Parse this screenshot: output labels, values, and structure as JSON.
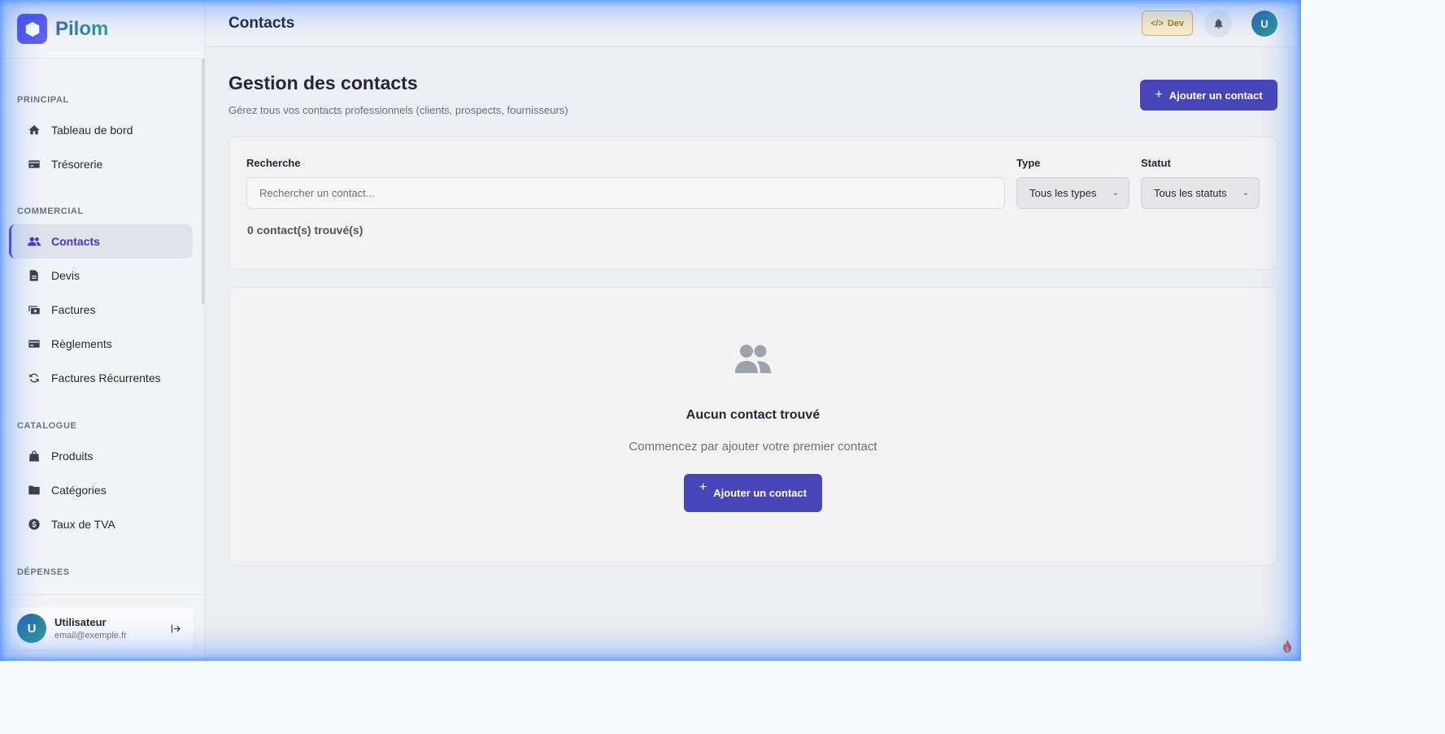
{
  "brand": {
    "name": "Pilom"
  },
  "sidebar": {
    "sections": [
      {
        "label": "PRINCIPAL"
      },
      {
        "label": "COMMERCIAL"
      },
      {
        "label": "CATALOGUE"
      },
      {
        "label": "DÉPENSES"
      }
    ],
    "items": [
      {
        "label": "Tableau de bord",
        "icon": "home-icon"
      },
      {
        "label": "Trésorerie",
        "icon": "card-icon"
      },
      {
        "label": "Contacts",
        "icon": "users-icon",
        "active": true
      },
      {
        "label": "Devis",
        "icon": "document-icon"
      },
      {
        "label": "Factures",
        "icon": "money-icon"
      },
      {
        "label": "Règlements",
        "icon": "card-icon"
      },
      {
        "label": "Factures Récurrentes",
        "icon": "recurring-icon"
      },
      {
        "label": "Produits",
        "icon": "bag-icon"
      },
      {
        "label": "Catégories",
        "icon": "folder-icon"
      },
      {
        "label": "Taux de TVA",
        "icon": "coin-icon"
      }
    ],
    "user": {
      "initial": "U",
      "name": "Utilisateur",
      "email": "email@exemple.fr"
    }
  },
  "topbar": {
    "title": "Contacts",
    "dev_badge": "Dev",
    "avatar_initial": "U"
  },
  "main": {
    "title": "Gestion des contacts",
    "subtitle": "Gérez tous vos contacts professionnels (clients, prospects, fournisseurs)",
    "add_button": "Ajouter un contact",
    "filters": {
      "search_label": "Recherche",
      "search_placeholder": "Rechercher un contact...",
      "search_value": "",
      "type_label": "Type",
      "type_value": "Tous les types",
      "status_label": "Statut",
      "status_value": "Tous les statuts"
    },
    "result_count": "0 contact(s) trouvé(s)",
    "empty": {
      "title": "Aucun contact trouvé",
      "subtitle": "Commencez par ajouter votre premier contact",
      "button": "Ajouter un contact"
    }
  },
  "colors": {
    "primary": "#4845b8",
    "accent_active": "#4338ca",
    "dev_badge": "#e0b24a",
    "glow": "#2d78ff"
  }
}
